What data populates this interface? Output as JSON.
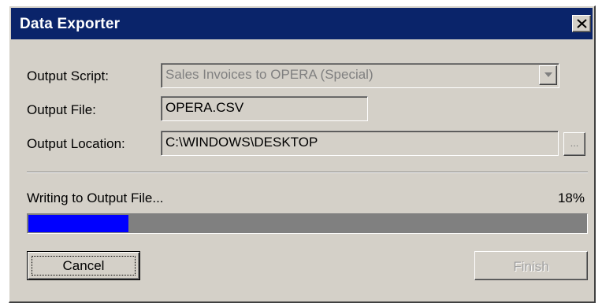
{
  "window": {
    "title": "Data Exporter"
  },
  "form": {
    "output_script_label": "Output Script:",
    "output_script_value": "Sales Invoices to OPERA (Special)",
    "output_file_label": "Output File:",
    "output_file_value": "OPERA.CSV",
    "output_location_label": "Output Location:",
    "output_location_value": "C:\\WINDOWS\\DESKTOP",
    "browse_label": "..."
  },
  "progress": {
    "status_text": "Writing to Output File...",
    "percent_text": "18%",
    "fraction": 0.18,
    "fill_color": "#0000ff"
  },
  "buttons": {
    "cancel_label": "Cancel",
    "finish_label": "Finish"
  },
  "colors": {
    "titlebar": "#0a246a",
    "face": "#d4d0c8"
  },
  "icons": {
    "close": "close-icon",
    "dropdown": "chevron-down-icon"
  }
}
